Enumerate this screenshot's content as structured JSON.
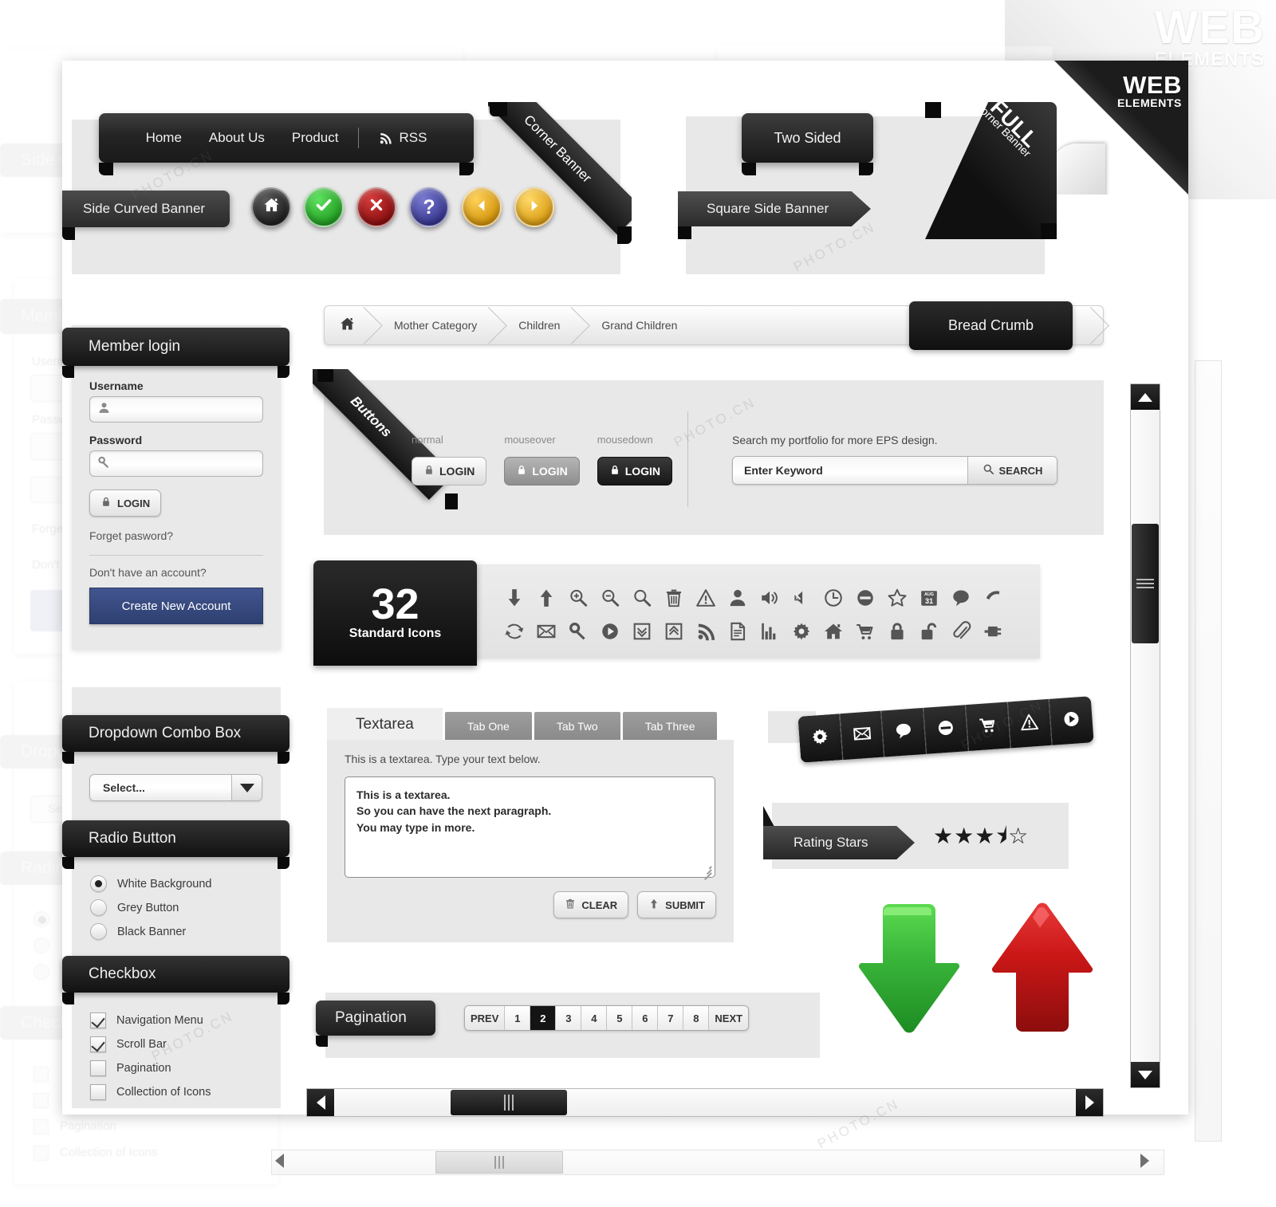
{
  "watermark": {
    "brand_top": "WEB",
    "brand_sub": "ELEMENTS",
    "corner_brand": "WEB",
    "corner_sub": "ELEMENTS",
    "photo_text": "PHOTO.CN"
  },
  "navbar": {
    "items": [
      "Home",
      "About Us",
      "Product"
    ],
    "rss_label": "RSS",
    "rss_icon": "rss-icon"
  },
  "banners": {
    "side_curved": "Side Curved Banner",
    "corner_banner": "Corner Banner",
    "two_sided": "Two Sided",
    "square_side": "Square Side Banner",
    "full_corner_line1": "FULL",
    "full_corner_line2": "Corner Banner"
  },
  "circle_buttons": [
    {
      "name": "home-circle-button",
      "icon": "home-icon",
      "color": "#2e2e2e"
    },
    {
      "name": "check-circle-button",
      "icon": "check-icon",
      "color": "#2fb62f"
    },
    {
      "name": "close-circle-button",
      "icon": "close-icon",
      "color": "#a51414"
    },
    {
      "name": "help-circle-button",
      "icon": "question-icon",
      "color": "#4a4aa8"
    },
    {
      "name": "prev-circle-button",
      "icon": "arrow-left-icon",
      "color": "#e6a81d"
    },
    {
      "name": "next-circle-button",
      "icon": "arrow-right-icon",
      "color": "#eeb21f"
    }
  ],
  "login": {
    "header": "Member login",
    "username_label": "Username",
    "username_value": "",
    "username_placeholder": "",
    "password_label": "Password",
    "password_value": "",
    "login_button": "LOGIN",
    "forgot_link": "Forget pasword?",
    "no_account_text": "Don't have an account?",
    "create_account_button": "Create New Account",
    "accent_color": "#3a4d86"
  },
  "breadcrumb": {
    "home_icon": "home-icon",
    "items": [
      "Mother Category",
      "Children",
      "Grand Children"
    ],
    "tag": "Bread Crumb"
  },
  "buttons_section": {
    "ribbon": "Buttons",
    "states": [
      "normal",
      "mouseover",
      "mousedown"
    ],
    "button_label": "LOGIN",
    "search_hint": "Search my portfolio for more EPS design.",
    "search_value": "Enter Keyword",
    "search_placeholder": "Enter Keyword",
    "search_button": "SEARCH"
  },
  "icons_section": {
    "count": "32",
    "caption": "Standard Icons",
    "icons": [
      "arrow-down-icon",
      "arrow-up-icon",
      "zoom-in-icon",
      "zoom-out-icon",
      "search-icon",
      "trash-icon",
      "warning-icon",
      "user-icon",
      "volume-on-icon",
      "volume-mute-icon",
      "clock-icon",
      "block-icon",
      "star-outline-icon",
      "calendar-icon",
      "comment-icon",
      "phone-icon",
      "refresh-icon",
      "envelope-icon",
      "key-icon",
      "play-icon",
      "collapse-down-icon",
      "collapse-up-icon",
      "rss-icon",
      "document-icon",
      "bar-chart-icon",
      "gear-icon",
      "home-icon",
      "cart-icon",
      "lock-closed-icon",
      "lock-open-icon",
      "paperclip-icon",
      "plug-icon"
    ]
  },
  "tabs_section": {
    "tabs": [
      {
        "label": "Textarea",
        "active": true
      },
      {
        "label": "Tab One",
        "active": false
      },
      {
        "label": "Tab Two",
        "active": false
      },
      {
        "label": "Tab Three",
        "active": false
      }
    ],
    "hint": "This is a textarea. Type your text below.",
    "textarea_value": "This is a textarea.\nSo you can have the next paragraph.\nYou may type in more.",
    "textarea_line1": "This is a textarea.",
    "textarea_line2": "So you can have the next paragraph.",
    "textarea_line3": "You may type in more.",
    "clear_button": "CLEAR",
    "submit_button": "SUBMIT"
  },
  "dropdown": {
    "header": "Dropdown Combo Box",
    "selected": "Select...",
    "arrow_icon": "chevron-down-icon"
  },
  "radio": {
    "header": "Radio Button",
    "options": [
      {
        "label": "White Background",
        "checked": true
      },
      {
        "label": "Grey Button",
        "checked": false
      },
      {
        "label": "Black Banner",
        "checked": false
      }
    ]
  },
  "checkbox": {
    "header": "Checkbox",
    "options": [
      {
        "label": "Navigation Menu",
        "checked": true
      },
      {
        "label": "Scroll Bar",
        "checked": true
      },
      {
        "label": "Pagination",
        "checked": false
      },
      {
        "label": "Collection of Icons",
        "checked": false
      }
    ]
  },
  "icon_strip": [
    "gear-icon",
    "envelope-icon",
    "comment-icon",
    "block-icon",
    "cart-icon",
    "warning-icon",
    "play-icon"
  ],
  "rating": {
    "label": "Rating Stars",
    "value": 3.5,
    "max": 5,
    "glyphs": [
      "★",
      "★",
      "★",
      "⯨",
      "☆"
    ]
  },
  "pagination": {
    "label": "Pagination",
    "prev": "PREV",
    "next": "NEXT",
    "pages": [
      "1",
      "2",
      "3",
      "4",
      "5",
      "6",
      "7",
      "8"
    ],
    "active_page": "2"
  },
  "big_arrows": [
    {
      "name": "download-arrow",
      "direction": "down",
      "color": "#2aa32a"
    },
    {
      "name": "upload-arrow",
      "direction": "up",
      "color": "#c21a1a"
    }
  ],
  "scrollbars": {
    "vertical": {
      "up_icon": "triangle-up-icon",
      "down_icon": "triangle-down-icon"
    },
    "horizontal": {
      "left_icon": "triangle-left-icon",
      "right_icon": "triangle-right-icon"
    }
  }
}
